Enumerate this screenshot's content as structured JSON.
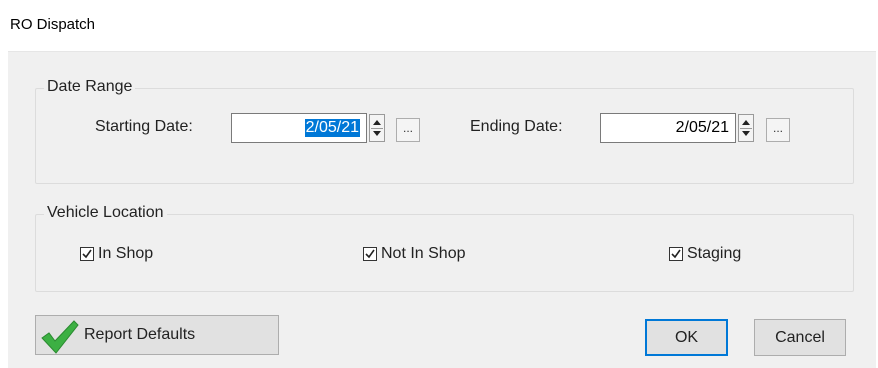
{
  "window": {
    "title": "RO Dispatch"
  },
  "date_range": {
    "legend": "Date Range",
    "start_label": "Starting Date:",
    "start_value": "2/05/21",
    "end_label": "Ending Date:",
    "end_value": "2/05/21",
    "picker_label": "..."
  },
  "vehicle_location": {
    "legend": "Vehicle Location",
    "options": [
      {
        "label": "In Shop",
        "checked": true
      },
      {
        "label": "Not In Shop",
        "checked": true
      },
      {
        "label": "Staging",
        "checked": true
      }
    ]
  },
  "buttons": {
    "report_defaults": "Report Defaults",
    "ok": "OK",
    "cancel": "Cancel"
  },
  "colors": {
    "selection": "#0078d7",
    "check_green": "#3cb043",
    "background": "#f0f0f0"
  },
  "icons": {
    "report_defaults_icon": "green-checkmark-icon"
  }
}
